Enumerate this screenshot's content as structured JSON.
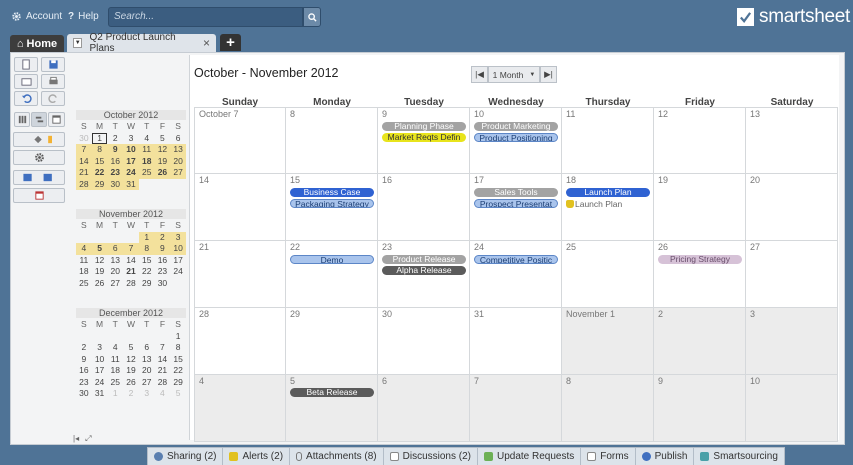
{
  "topbar": {
    "account_label": "Account",
    "help_label": "Help",
    "search_placeholder": "Search...",
    "logo_text": "smartsheet"
  },
  "tabs": {
    "home_label": "Home",
    "doc_label": "Q2 Product Launch Plans",
    "add_label": "+"
  },
  "calendar": {
    "title": "October - November 2012",
    "view_label": "1 Month",
    "weekdays": [
      "Sunday",
      "Monday",
      "Tuesday",
      "Wednesday",
      "Thursday",
      "Friday",
      "Saturday"
    ],
    "weeks": [
      [
        "October 7",
        "8",
        "9",
        "10",
        "11",
        "12",
        "13"
      ],
      [
        "14",
        "15",
        "16",
        "17",
        "18",
        "19",
        "20"
      ],
      [
        "21",
        "22",
        "23",
        "24",
        "25",
        "26",
        "27"
      ],
      [
        "28",
        "29",
        "30",
        "31",
        "November 1",
        "2",
        "3"
      ],
      [
        "4",
        "5",
        "6",
        "7",
        "8",
        "9",
        "10"
      ]
    ],
    "events": {
      "planning_phase": "Planning Phase",
      "market_reqts": "Market Reqts Defin",
      "product_marketing": "Product Marketing",
      "product_positioning": "Product Positioning",
      "business_case": "Business Case",
      "packaging_strategy": "Packaging Strategy",
      "sales_tools": "Sales Tools",
      "prospect_presentation": "Prospect Presentat",
      "launch_plan": "Launch Plan",
      "launch_plan_note": "Launch Plan",
      "demo": "Demo",
      "product_release": "Product Release",
      "alpha_release": "Alpha Release",
      "competitive_position": "Competitive Positic",
      "pricing_strategy": "Pricing Strategy",
      "beta_release": "Beta Release"
    }
  },
  "mini_calendars": {
    "weekday_letters": [
      "S",
      "M",
      "T",
      "W",
      "T",
      "F",
      "S"
    ],
    "october": {
      "title": "October 2012",
      "days": [
        "30",
        "1",
        "2",
        "3",
        "4",
        "5",
        "6",
        "7",
        "8",
        "9",
        "10",
        "11",
        "12",
        "13",
        "14",
        "15",
        "16",
        "17",
        "18",
        "19",
        "20",
        "21",
        "22",
        "23",
        "24",
        "25",
        "26",
        "27",
        "28",
        "29",
        "30",
        "31"
      ]
    },
    "november": {
      "title": "November 2012",
      "days": [
        "1",
        "2",
        "3",
        "4",
        "5",
        "6",
        "7",
        "8",
        "9",
        "10",
        "11",
        "12",
        "13",
        "14",
        "15",
        "16",
        "17",
        "18",
        "19",
        "20",
        "21",
        "22",
        "23",
        "24",
        "25",
        "26",
        "27",
        "28",
        "29",
        "30"
      ]
    },
    "december": {
      "title": "December 2012",
      "days": [
        "1",
        "2",
        "3",
        "4",
        "5",
        "6",
        "7",
        "8",
        "9",
        "10",
        "11",
        "12",
        "13",
        "14",
        "15",
        "16",
        "17",
        "18",
        "19",
        "20",
        "21",
        "22",
        "23",
        "24",
        "25",
        "26",
        "27",
        "28",
        "29",
        "30",
        "31",
        "1",
        "2",
        "3",
        "4",
        "5"
      ]
    }
  },
  "bottombar": {
    "sharing": "Sharing (2)",
    "alerts": "Alerts (2)",
    "attachments": "Attachments (8)",
    "discussions": "Discussions (2)",
    "update_requests": "Update Requests",
    "forms": "Forms",
    "publish": "Publish",
    "smartsourcing": "Smartsourcing"
  },
  "colors": {
    "background": "#4f7396",
    "highlight": "#f3e19c",
    "event_blue": "#2f62d2",
    "event_light_blue": "#a9c4ec",
    "event_grey": "#a3a3a3",
    "event_yellow": "#e8e41c"
  }
}
